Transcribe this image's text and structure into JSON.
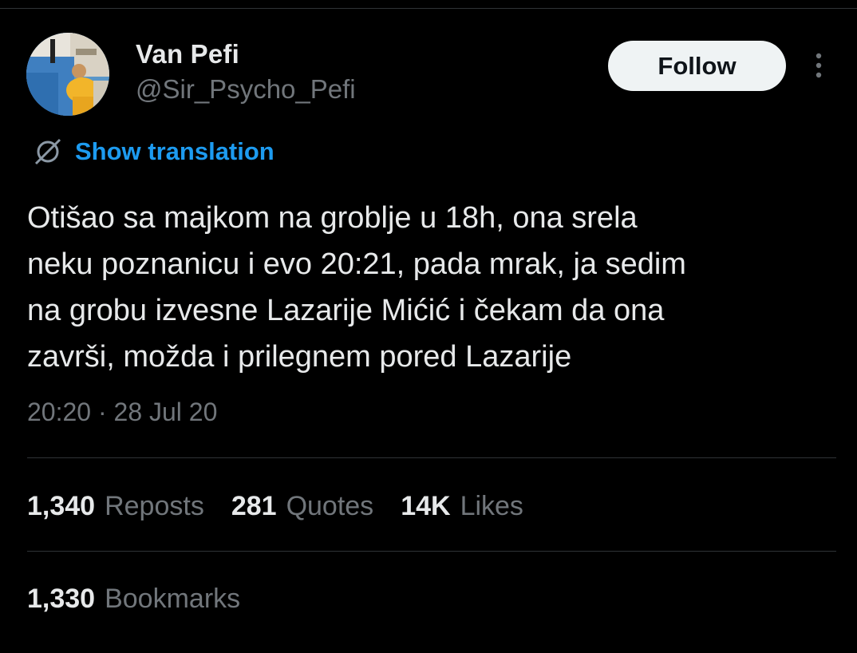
{
  "author": {
    "display_name": "Van Pefi",
    "handle": "@Sir_Psycho_Pefi"
  },
  "follow_button": {
    "label": "Follow"
  },
  "translation": {
    "label": "Show translation"
  },
  "tweet": {
    "text": "Otišao sa majkom na groblje u 18h, ona srela\nneku poznanicu i evo 20:21, pada mrak, ja sedim\nna grobu izvesne Lazarije Mićić i čekam da ona\nzavrši, možda i prilegnem pored Lazarije",
    "timestamp": "20:20 · 28 Jul 20"
  },
  "stats": {
    "reposts": {
      "count": "1,340",
      "label": "Reposts"
    },
    "quotes": {
      "count": "281",
      "label": "Quotes"
    },
    "likes": {
      "count": "14K",
      "label": "Likes"
    },
    "bookmarks": {
      "count": "1,330",
      "label": "Bookmarks"
    }
  },
  "colors": {
    "background": "#000000",
    "primary_text": "#e7e9ea",
    "secondary_text": "#71767b",
    "link_blue": "#1d9bf0",
    "divider": "#2f3336",
    "follow_button_bg": "#eff3f4"
  },
  "icons": {
    "more": "more-options-icon",
    "translate": "translate-globe-icon"
  }
}
